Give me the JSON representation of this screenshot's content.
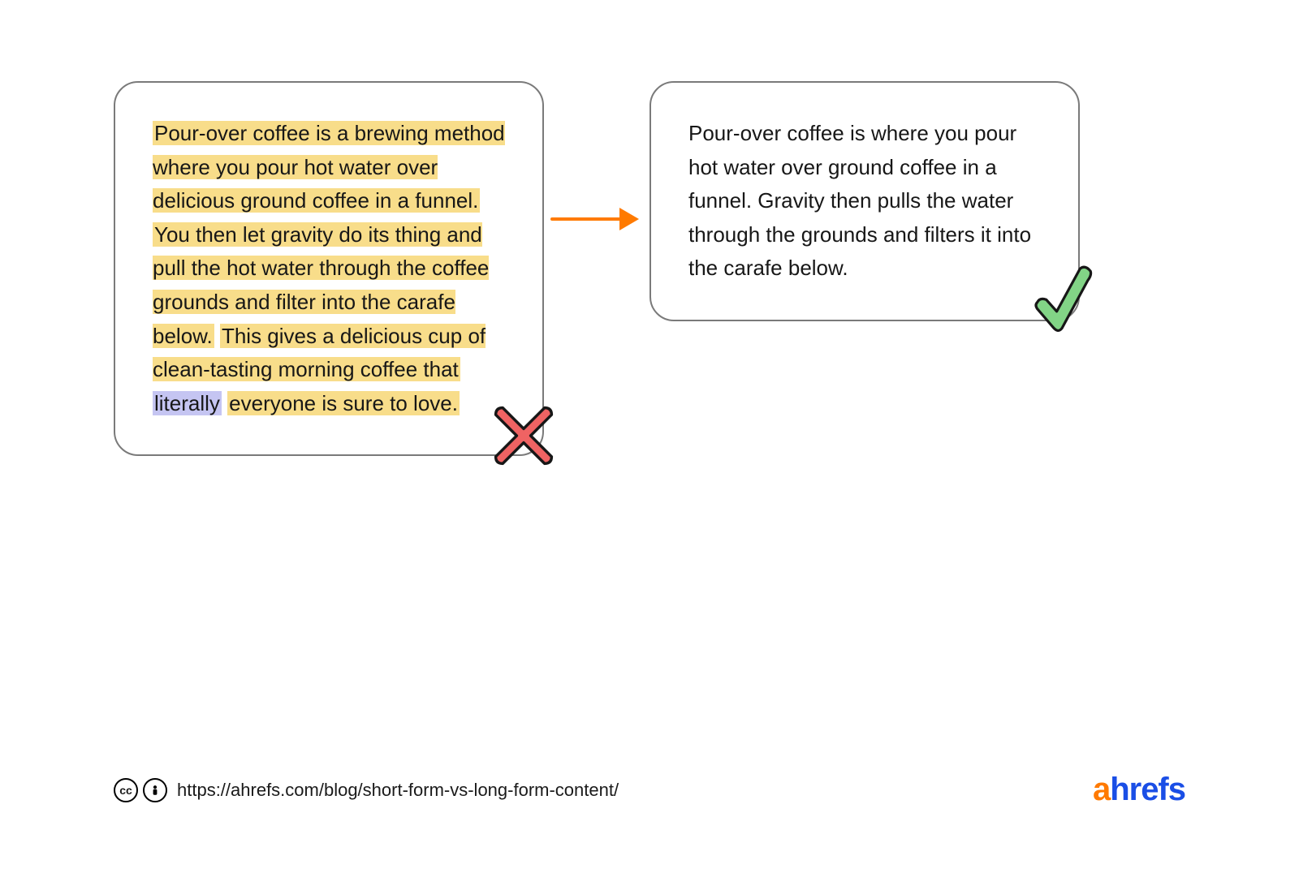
{
  "left_card": {
    "segments": [
      {
        "text": "Pour-over coffee is a brewing method where you pour hot water over delicious ground coffee in a funnel.",
        "hl": "yellow"
      },
      {
        "text": " ",
        "hl": null
      },
      {
        "text": "You then let gravity do its thing and pull the hot water through the coffee grounds and filter into the carafe below.",
        "hl": "yellow"
      },
      {
        "text": " ",
        "hl": null
      },
      {
        "text": "This gives a delicious cup of clean-tasting morning coffee that",
        "hl": "yellow"
      },
      {
        "text": " ",
        "hl": null
      },
      {
        "text": "literally",
        "hl": "purple"
      },
      {
        "text": " ",
        "hl": null
      },
      {
        "text": "everyone is sure to love.",
        "hl": "yellow"
      }
    ]
  },
  "right_card": {
    "text": "Pour-over coffee is where you pour hot water over ground coffee in a funnel. Gravity then pulls the water through the grounds and filters it into the carafe below."
  },
  "footer": {
    "url": "https://ahrefs.com/blog/short-form-vs-long-form-content/",
    "cc": "cc",
    "by_char": "i",
    "logo_a": "a",
    "logo_rest": "hrefs"
  },
  "colors": {
    "arrow": "#ff7a00",
    "cross_fill": "#ef6363",
    "check_fill": "#82d486",
    "stroke": "#171717"
  }
}
